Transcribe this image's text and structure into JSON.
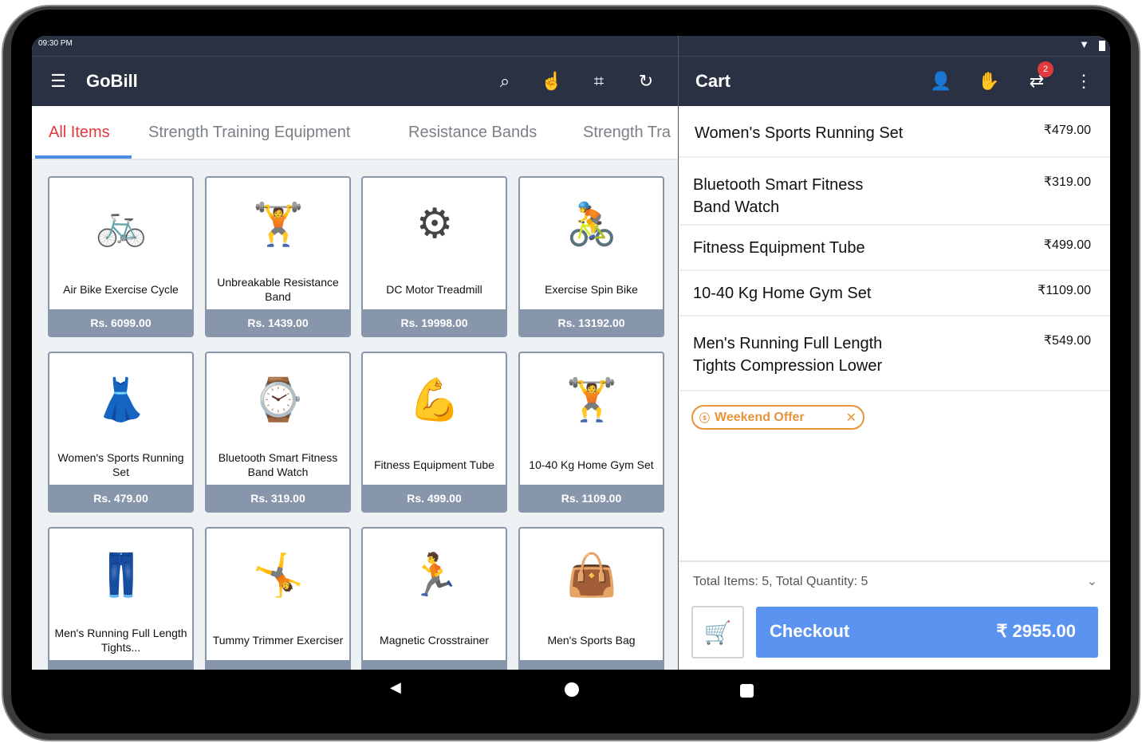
{
  "status": {
    "time": "09:30 PM"
  },
  "app": {
    "title": "GoBill"
  },
  "tabs": [
    {
      "label": "All Items",
      "active": true
    },
    {
      "label": "Strength Training Equipment"
    },
    {
      "label": "Resistance Bands"
    },
    {
      "label": "Strength Tra"
    }
  ],
  "products": [
    {
      "name": "Air Bike Exercise Cycle",
      "price": "Rs. 6099.00",
      "icon": "🚲"
    },
    {
      "name": "Unbreakable Resistance Band",
      "price": "Rs. 1439.00",
      "icon": "🏋"
    },
    {
      "name": "DC Motor Treadmill",
      "price": "Rs. 19998.00",
      "icon": "⚙"
    },
    {
      "name": "Exercise Spin Bike",
      "price": "Rs. 13192.00",
      "icon": "🚴"
    },
    {
      "name": "Women's Sports Running Set",
      "price": "Rs. 479.00",
      "icon": "👗"
    },
    {
      "name": "Bluetooth Smart Fitness Band Watch",
      "price": "Rs. 319.00",
      "icon": "⌚"
    },
    {
      "name": "Fitness Equipment Tube",
      "price": "Rs. 499.00",
      "icon": "💪"
    },
    {
      "name": "10-40 Kg Home Gym Set",
      "price": "Rs. 1109.00",
      "icon": "🏋"
    },
    {
      "name": "Men's Running Full Length Tights...",
      "price": "",
      "icon": "👖"
    },
    {
      "name": "Tummy Trimmer Exerciser",
      "price": "",
      "icon": "🤸"
    },
    {
      "name": "Magnetic Crosstrainer",
      "price": "",
      "icon": "🏃"
    },
    {
      "name": "Men's Sports Bag",
      "price": "",
      "icon": "👜"
    }
  ],
  "cart": {
    "title": "Cart",
    "badge": "2",
    "items": [
      {
        "name": "Women's Sports Running Set",
        "price": "₹479.00"
      },
      {
        "name": "Bluetooth Smart Fitness Band Watch",
        "price": "₹319.00"
      },
      {
        "name": "Fitness Equipment Tube",
        "price": "₹499.00"
      },
      {
        "name": "10-40 Kg Home Gym Set",
        "price": "₹1109.00"
      },
      {
        "name": "Men's Running Full Length Tights Compression Lower",
        "price": "₹549.00"
      }
    ],
    "offer": "Weekend Offer",
    "summary": "Total Items: 5, Total Quantity: 5",
    "checkout_label": "Checkout",
    "total": "₹ 2955.00"
  },
  "colors": {
    "header": "#2a3142",
    "accent": "#5b93f0",
    "active_tab": "#e0393e",
    "offer": "#e8943a",
    "price_band": "#8896ab"
  }
}
